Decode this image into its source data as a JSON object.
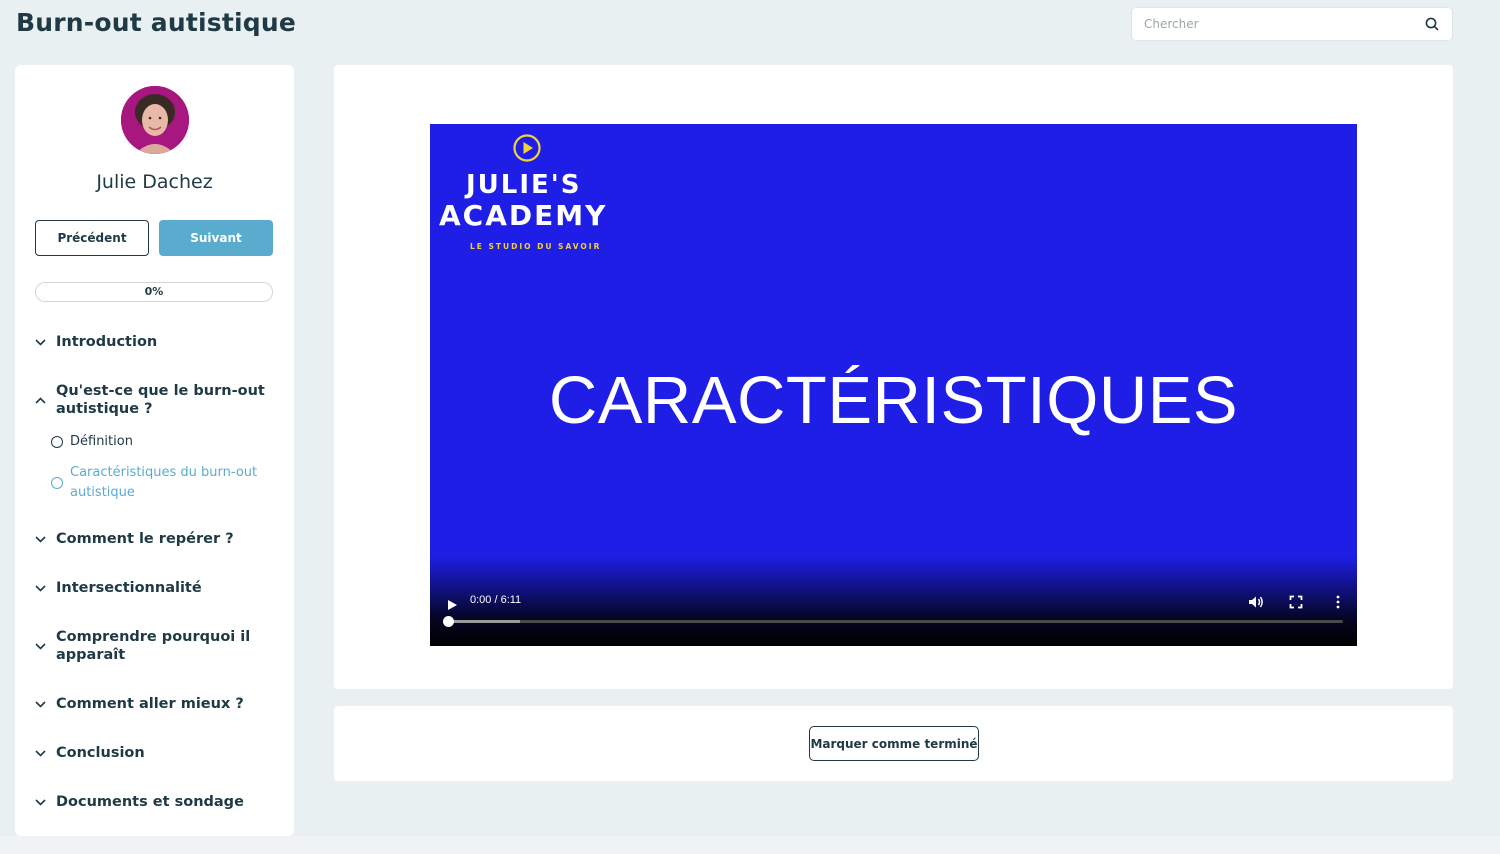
{
  "page": {
    "title": "Burn-out autistique"
  },
  "search": {
    "placeholder": "Chercher",
    "icon": "search-icon"
  },
  "sidebar": {
    "instructor_name": "Julie Dachez",
    "prev_label": "Précédent",
    "next_label": "Suivant",
    "progress": {
      "value": 0,
      "label": "0%"
    },
    "sections": [
      {
        "label": "Introduction",
        "expanded": false
      },
      {
        "label": "Qu'est-ce que le burn-out autistique ?",
        "expanded": true,
        "lessons": [
          {
            "label": "Définition",
            "active": false
          },
          {
            "label": "Caractéristiques du burn-out autistique",
            "active": true
          }
        ]
      },
      {
        "label": "Comment le repérer ?",
        "expanded": false
      },
      {
        "label": "Intersectionnalité",
        "expanded": false
      },
      {
        "label": "Comprendre pourquoi il apparaît",
        "expanded": false
      },
      {
        "label": "Comment aller mieux ?",
        "expanded": false
      },
      {
        "label": "Conclusion",
        "expanded": false
      },
      {
        "label": "Documents et sondage",
        "expanded": false
      }
    ]
  },
  "video": {
    "logo_line1": "JULIE'S",
    "logo_line2": "ACADEMY",
    "logo_tagline": "LE STUDIO DU SAVOIR",
    "slide_title": "CARACTÉRISTIQUES",
    "time": "0:00 / 6:11",
    "played_fraction": 0,
    "buffered_fraction": 0.08,
    "colors": {
      "background": "#1e1ee6",
      "logo_accent": "#f2d23a"
    }
  },
  "actions": {
    "complete_label": "Marquer comme terminé"
  },
  "colors": {
    "accent": "#5aacce",
    "text": "#1f3a44",
    "page_bg": "#e8f0f2"
  }
}
